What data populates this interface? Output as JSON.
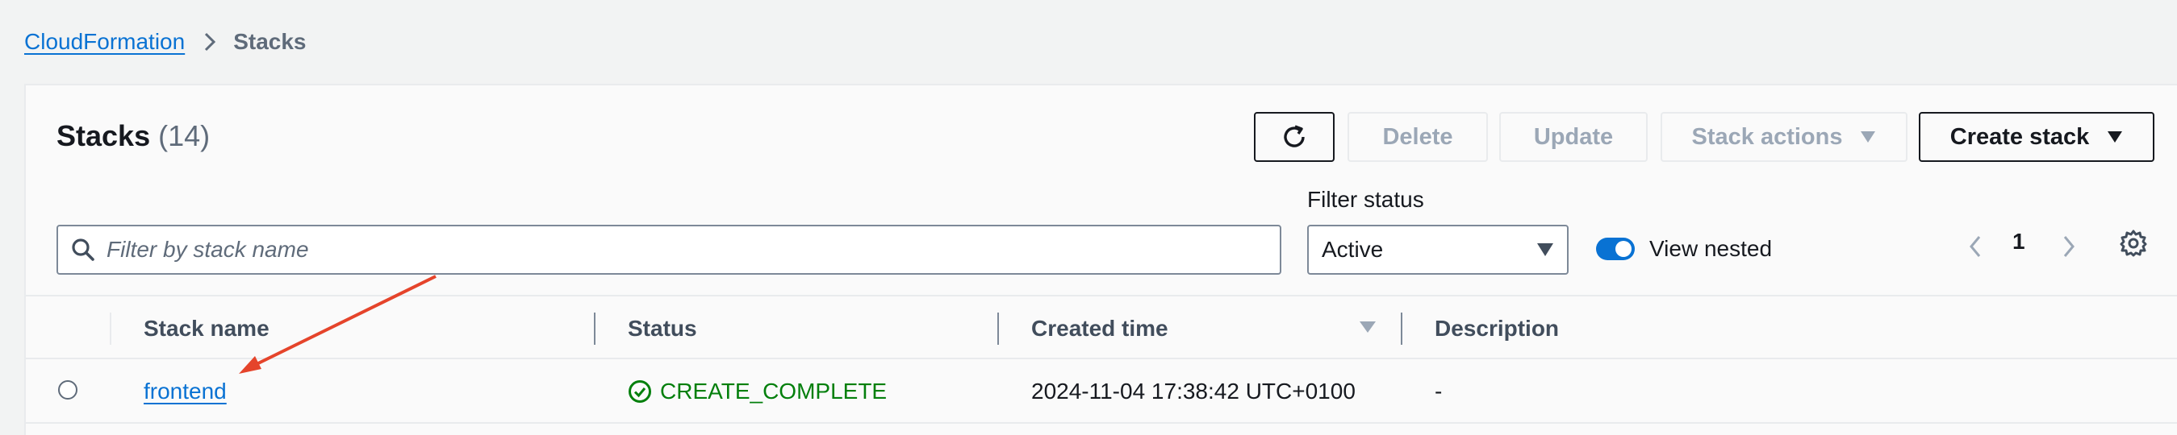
{
  "breadcrumb": {
    "root": "CloudFormation",
    "current": "Stacks"
  },
  "header": {
    "title": "Stacks",
    "count": "(14)"
  },
  "toolbar": {
    "delete_label": "Delete",
    "update_label": "Update",
    "stack_actions_label": "Stack actions",
    "create_stack_label": "Create stack"
  },
  "search": {
    "placeholder": "Filter by stack name",
    "value": ""
  },
  "filter_status": {
    "label": "Filter status",
    "selected": "Active"
  },
  "view_nested": {
    "label": "View nested",
    "enabled": true
  },
  "pagination": {
    "current_page": "1"
  },
  "table": {
    "columns": [
      "Stack name",
      "Status",
      "Created time",
      "Description"
    ],
    "rows": [
      {
        "stack_name": "frontend",
        "status": "CREATE_COMPLETE",
        "created_time": "2024-11-04 17:38:42 UTC+0100",
        "description": "-"
      }
    ]
  },
  "colors": {
    "link": "#0972d3",
    "success": "#037f0c",
    "annotation_arrow": "#e5442b"
  },
  "icons": [
    "chevron-right-icon",
    "refresh-icon",
    "caret-down-icon",
    "search-icon",
    "chevron-left-icon",
    "gear-icon",
    "check-circle-icon"
  ]
}
